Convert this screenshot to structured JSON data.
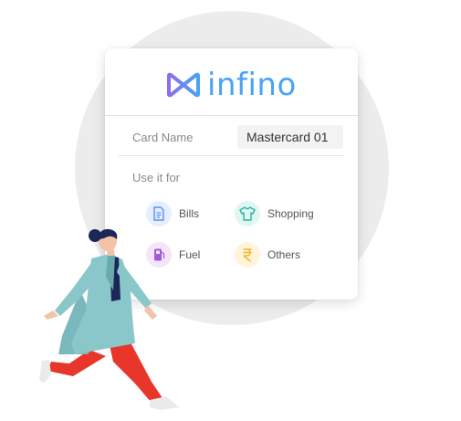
{
  "brand": {
    "name": "infino",
    "colors": {
      "primary": "#4aa3f5",
      "accent": "#8a6ff0"
    }
  },
  "card_name": {
    "label": "Card Name",
    "value": "Mastercard 01"
  },
  "use_it_for": {
    "label": "Use it for",
    "options": [
      {
        "label": "Bills",
        "icon": "document-icon",
        "color": "#5b8def",
        "bg": "#e6efff"
      },
      {
        "label": "Shopping",
        "icon": "shirt-icon",
        "color": "#2bb5a0",
        "bg": "#e0f6f2"
      },
      {
        "label": "Fuel",
        "icon": "fuel-pump-icon",
        "color": "#a35ad6",
        "bg": "#f3e6fb"
      },
      {
        "label": "Others",
        "icon": "rupee-icon",
        "color": "#f2b530",
        "bg": "#fff4da"
      }
    ]
  }
}
